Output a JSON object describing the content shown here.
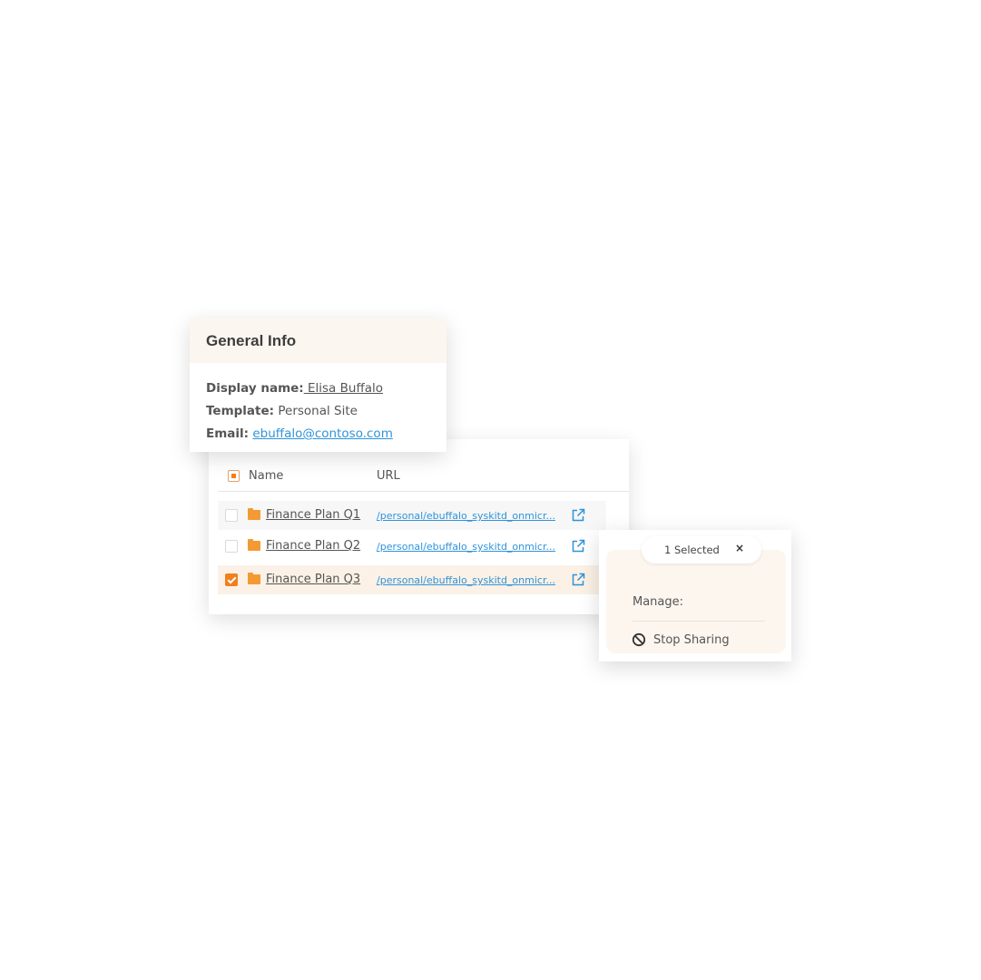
{
  "general_info": {
    "title": "General Info",
    "display_name_label": "Display name:",
    "display_name_value": " Elisa Buffalo",
    "template_label": "Template:",
    "template_value": " Personal Site",
    "email_label": "Email:",
    "email_value": "ebuffalo@contoso.com"
  },
  "table": {
    "columns": {
      "name": "Name",
      "url": "URL"
    },
    "header_checkbox_state": "partial",
    "rows": [
      {
        "name": "Finance Plan Q1",
        "url": "/personal/ebuffalo_syskitd_onmicr...",
        "checked": false
      },
      {
        "name": "Finance Plan Q2",
        "url": "/personal/ebuffalo_syskitd_onmicr...",
        "checked": false
      },
      {
        "name": "Finance Plan Q3",
        "url": "/personal/ebuffalo_syskitd_onmicr...",
        "checked": true
      }
    ]
  },
  "selection": {
    "count_text": "1 Selected",
    "close_glyph": "×",
    "manage_label": "Manage:",
    "stop_sharing_label": "Stop Sharing"
  },
  "colors": {
    "accent": "#f0801e",
    "folder": "#f39a34",
    "link": "#2f93d9",
    "header_bg": "#fcf6f0",
    "selected_row_bg": "#fbf1e6"
  },
  "icons": {
    "folder": "folder-icon",
    "external_link": "external-link-icon",
    "stop_sharing": "ban-icon",
    "close": "close-icon"
  }
}
